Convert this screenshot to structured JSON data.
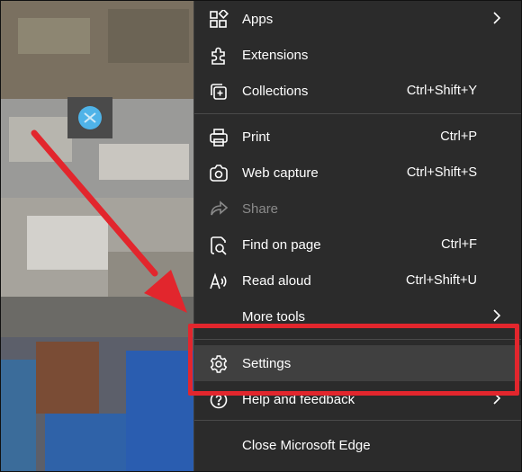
{
  "menu": {
    "items": [
      {
        "label": "Apps",
        "shortcut": "",
        "submenu": true,
        "icon": "apps-icon",
        "disabled": false
      },
      {
        "label": "Extensions",
        "shortcut": "",
        "submenu": false,
        "icon": "extensions-icon",
        "disabled": false
      },
      {
        "label": "Collections",
        "shortcut": "Ctrl+Shift+Y",
        "submenu": false,
        "icon": "collections-icon",
        "disabled": false
      },
      {
        "label": "Print",
        "shortcut": "Ctrl+P",
        "submenu": false,
        "icon": "print-icon",
        "disabled": false
      },
      {
        "label": "Web capture",
        "shortcut": "Ctrl+Shift+S",
        "submenu": false,
        "icon": "web-capture-icon",
        "disabled": false
      },
      {
        "label": "Share",
        "shortcut": "",
        "submenu": false,
        "icon": "share-icon",
        "disabled": true
      },
      {
        "label": "Find on page",
        "shortcut": "Ctrl+F",
        "submenu": false,
        "icon": "find-on-page-icon",
        "disabled": false
      },
      {
        "label": "Read aloud",
        "shortcut": "Ctrl+Shift+U",
        "submenu": false,
        "icon": "read-aloud-icon",
        "disabled": false
      },
      {
        "label": "More tools",
        "shortcut": "",
        "submenu": true,
        "icon": "",
        "disabled": false
      },
      {
        "label": "Settings",
        "shortcut": "",
        "submenu": false,
        "icon": "settings-icon",
        "disabled": false,
        "highlighted": true
      },
      {
        "label": "Help and feedback",
        "shortcut": "",
        "submenu": true,
        "icon": "help-icon",
        "disabled": false
      },
      {
        "label": "Close Microsoft Edge",
        "shortcut": "",
        "submenu": false,
        "icon": "",
        "disabled": false
      }
    ]
  },
  "colors": {
    "menu_bg": "#2b2b2b",
    "highlight_bg": "#404040",
    "annotation_red": "#e2262d",
    "disabled_text": "#8a8a8a"
  }
}
